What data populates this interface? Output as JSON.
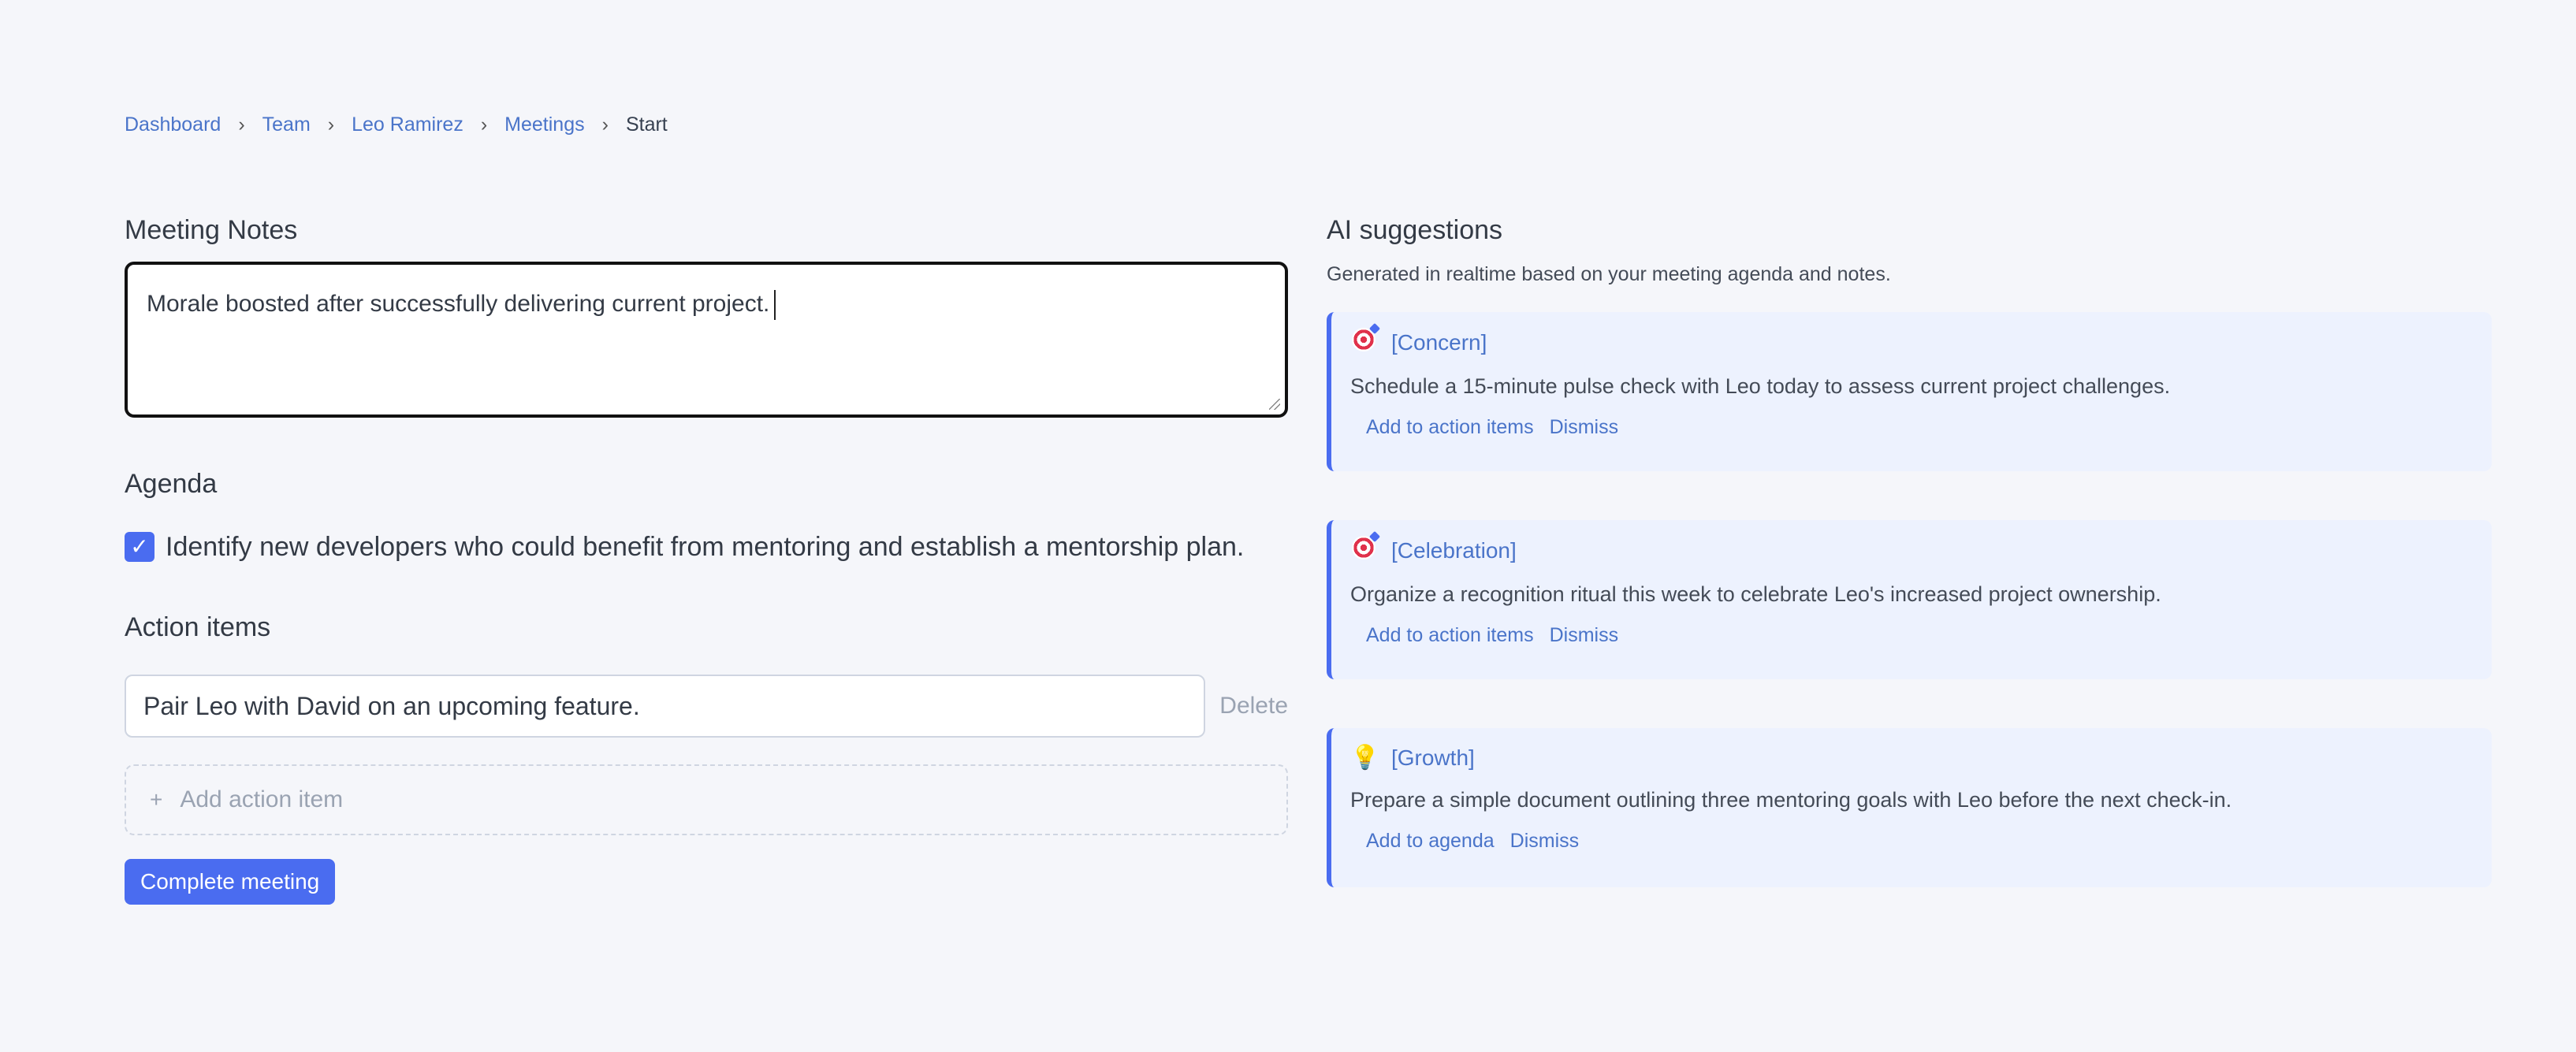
{
  "breadcrumb": {
    "items": [
      "Dashboard",
      "Team",
      "Leo Ramirez",
      "Meetings"
    ],
    "current": "Start",
    "separator": "›"
  },
  "notes": {
    "title": "Meeting Notes",
    "value": "Morale boosted after successfully delivering current project."
  },
  "agenda": {
    "title": "Agenda",
    "items": [
      {
        "text": "Identify new developers who could benefit from mentoring and establish a mentorship plan.",
        "checked": true,
        "check_glyph": "✓"
      }
    ]
  },
  "action_items": {
    "title": "Action items",
    "items": [
      {
        "value": "Pair Leo with David on an upcoming feature.",
        "delete_label": "Delete"
      }
    ],
    "add_label": "Add action item",
    "add_glyph": "+"
  },
  "complete_button": "Complete meeting",
  "ai": {
    "title": "AI suggestions",
    "subtitle": "Generated in realtime based on your meeting agenda and notes.",
    "suggestions": [
      {
        "icon": "target-icon",
        "tag": "[Concern]",
        "text": "Schedule a 15-minute pulse check with Leo today to assess current project challenges.",
        "primary_action": "Add to action items",
        "dismiss": "Dismiss"
      },
      {
        "icon": "target-icon",
        "tag": "[Celebration]",
        "text": "Organize a recognition ritual this week to celebrate Leo's increased project ownership.",
        "primary_action": "Add to action items",
        "dismiss": "Dismiss"
      },
      {
        "icon": "lightbulb-icon",
        "tag": "[Growth]",
        "text": "Prepare a simple document outlining three mentoring goals with Leo before the next check-in.",
        "primary_action": "Add to agenda",
        "dismiss": "Dismiss"
      }
    ]
  },
  "colors": {
    "accent": "#4a6cf0",
    "link": "#4a74c9",
    "background": "#f5f6fa",
    "card_background": "#edf2fe"
  }
}
